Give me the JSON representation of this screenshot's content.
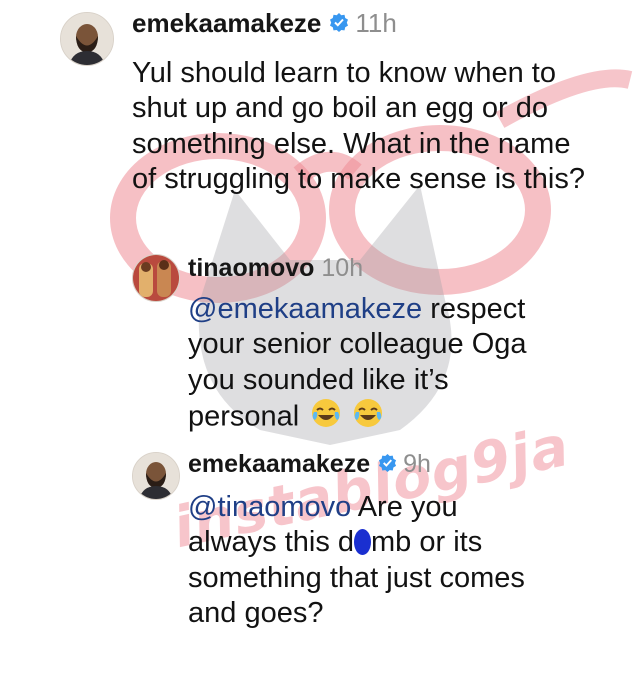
{
  "comments": [
    {
      "username": "emekaamakeze",
      "verified": true,
      "time": "11h",
      "text": "Yul should learn to know when to shut up and go boil an egg or do something else. What in the name of struggling to make sense is this?"
    },
    {
      "username": "tinaomovo",
      "verified": false,
      "time": "10h",
      "mention": "@emekaamakeze",
      "text_lines": [
        "respect",
        "your senior colleague Oga",
        "you sounded like it’s",
        "personal"
      ],
      "emojis": [
        "face-with-tears-of-joy-icon",
        "face-with-tears-of-joy-icon"
      ]
    },
    {
      "username": "emekaamakeze",
      "verified": true,
      "time": "9h",
      "mention": "@tinaomovo",
      "text_lines": [
        "Are you",
        "always this d",
        "mb or its",
        "something that just comes",
        "and goes?"
      ]
    }
  ],
  "watermark": {
    "text": "instablog9ja"
  },
  "colors": {
    "mention": "#1f3f86",
    "verified": "#3897f0",
    "watermark": "#f096a0",
    "censor_blob": "#1a2fd0"
  }
}
